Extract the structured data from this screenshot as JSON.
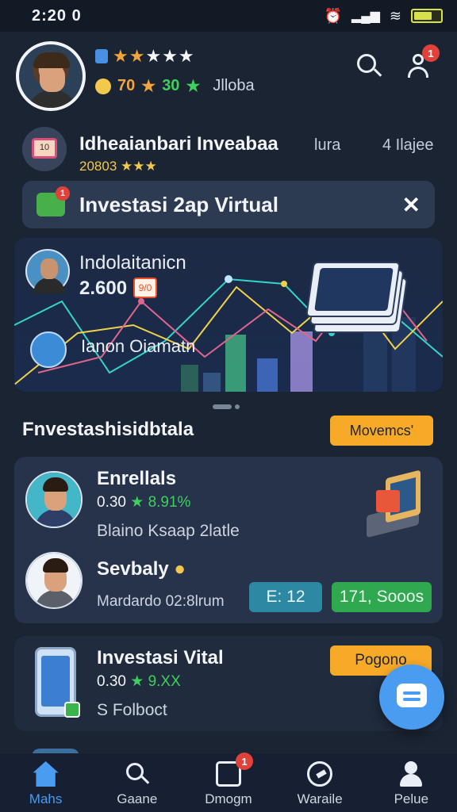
{
  "status_bar": {
    "time": "2:20 0"
  },
  "profile": {
    "stars_filled": 2,
    "stars_total": 5,
    "stat_orange": "70",
    "stat_green": "30",
    "stat_text": "Jlloba"
  },
  "header_actions": {
    "user_badge": "1"
  },
  "info": {
    "title": "Idheaianbari Inveabaa",
    "subtitle": "20803 ★★★",
    "right_1": "lura",
    "right_2": "4 Ilajee"
  },
  "banner": {
    "text": "Investasi 2ap Virtual",
    "badge": "1",
    "close_glyph": "✕"
  },
  "hero": {
    "title": "Indolaitanicn",
    "number": "2.600",
    "number_badge": "9/0",
    "label": "Ianon Oiamatn"
  },
  "section": {
    "title": "Fnvestashisidbtala",
    "button": "Movemcs'"
  },
  "list": [
    {
      "title": "Enrellals",
      "value": "0.30",
      "change": "★ 8.91%",
      "desc": "Blaino Ksaap 2latle"
    },
    {
      "title": "Sevbaly",
      "desc": "Mardardo 02:8lrum",
      "chip_blue": "E: 12",
      "chip_green": "171, Sooos"
    }
  ],
  "card2": {
    "title": "Investasi Vital",
    "value": "0.30",
    "change": "★ 9.XX",
    "desc": "S Folboct",
    "button": "Pogono"
  },
  "bottom_nav": [
    {
      "label": "Mahs",
      "icon": "home-icon",
      "active": true
    },
    {
      "label": "Gaane",
      "icon": "search-icon"
    },
    {
      "label": "Dmogm",
      "icon": "portfolio-icon",
      "badge": "1"
    },
    {
      "label": "Waraile",
      "icon": "wallet-icon"
    },
    {
      "label": "Pelue",
      "icon": "profile-icon"
    }
  ],
  "colors": {
    "background": "#1b2433",
    "card": "#27334a",
    "accent_blue": "#4a9cf0",
    "accent_orange": "#f7a928",
    "positive": "#3ecf5e",
    "badge_red": "#e0413a"
  }
}
